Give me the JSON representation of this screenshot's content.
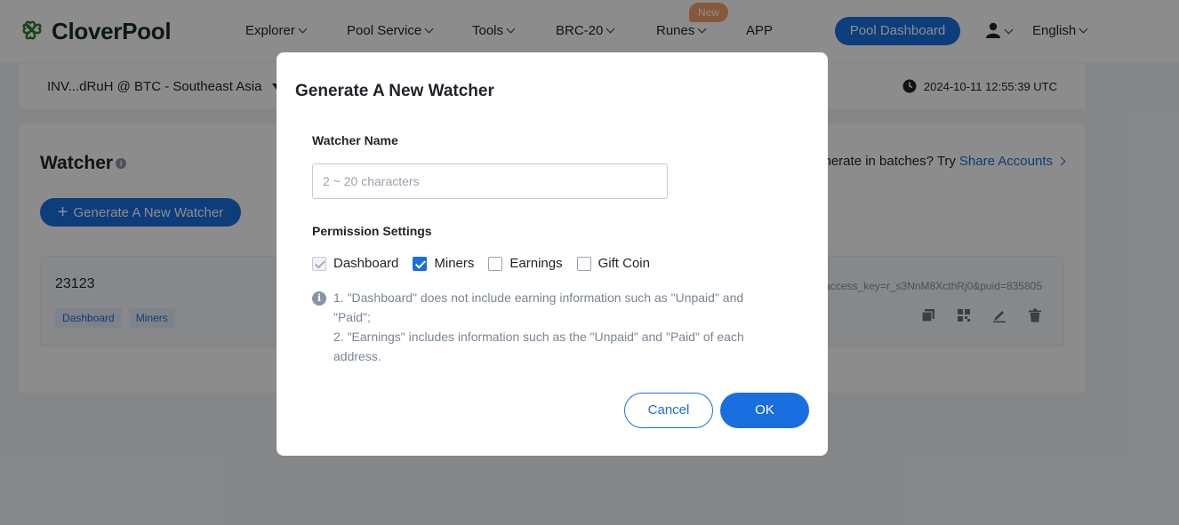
{
  "header": {
    "brand": "CloverPool",
    "nav": [
      {
        "label": "Explorer"
      },
      {
        "label": "Pool Service"
      },
      {
        "label": "Tools"
      },
      {
        "label": "BRC-20"
      },
      {
        "label": "Runes"
      },
      {
        "label": "APP"
      }
    ],
    "new_badge": "New",
    "pool_dashboard": "Pool Dashboard",
    "language": "English"
  },
  "subbar": {
    "account": "INV...dRuH @ BTC - Southeast Asia",
    "time": "2024-10-11 12:55:39 UTC"
  },
  "watcher_page": {
    "title": "Watcher",
    "generate_button": "Generate A New Watcher",
    "batch_prefix": "enerate in batches? Try",
    "batch_link": "Share Accounts",
    "entry": {
      "name": "23123",
      "tags": [
        "Dashboard",
        "Miners"
      ],
      "url": "access_key=r_s3NnM8XcthRj0&puid=835805"
    }
  },
  "modal": {
    "title": "Generate A New Watcher",
    "name_label": "Watcher Name",
    "name_placeholder": "2 ~ 20 characters",
    "name_value": "",
    "permissions_label": "Permission Settings",
    "permissions": [
      {
        "label": "Dashboard",
        "checked": true,
        "disabled": true
      },
      {
        "label": "Miners",
        "checked": true,
        "disabled": false
      },
      {
        "label": "Earnings",
        "checked": false,
        "disabled": false
      },
      {
        "label": "Gift Coin",
        "checked": false,
        "disabled": false
      }
    ],
    "note_1": "1. \"Dashboard\" does not include earning information such as \"Unpaid\" and \"Paid\";",
    "note_2": "2. \"Earnings\" includes information such as the \"Unpaid\" and \"Paid\" of each address.",
    "cancel": "Cancel",
    "ok": "OK"
  },
  "colors": {
    "accent": "#1a6fe0",
    "badge": "#f5a26b",
    "logo_green": "#2d7a3a"
  }
}
